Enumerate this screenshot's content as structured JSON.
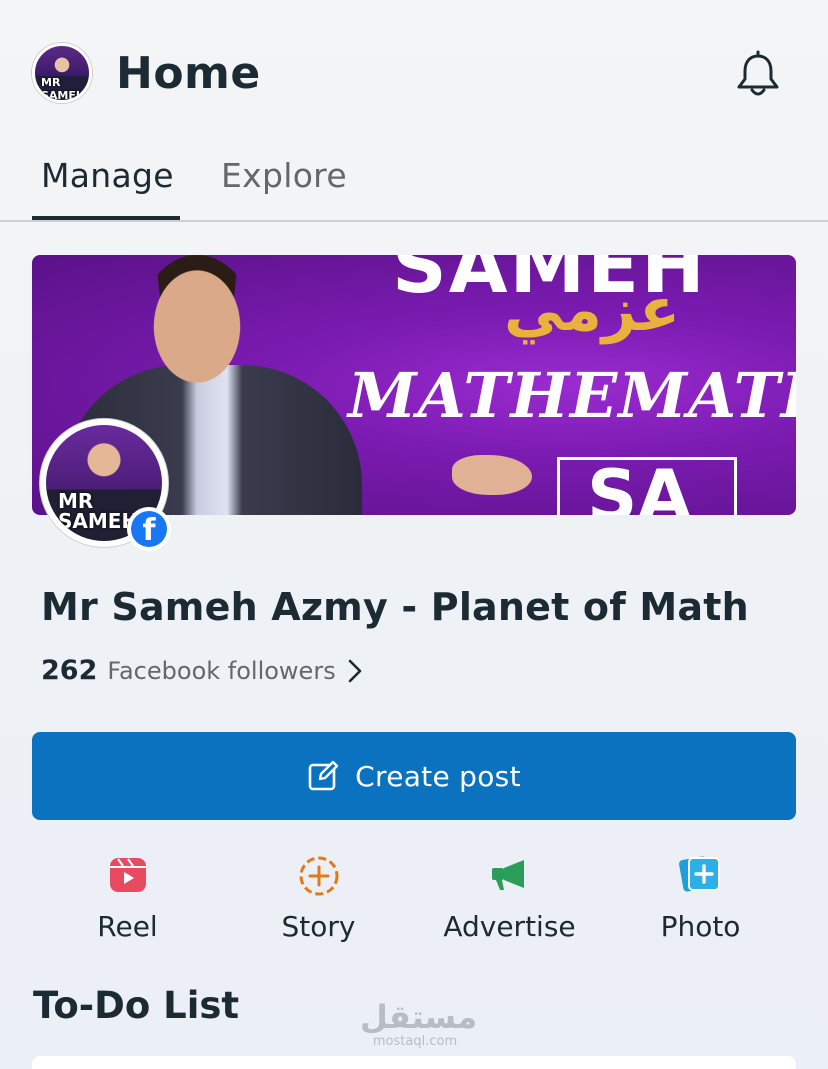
{
  "header": {
    "title": "Home",
    "avatar_text": "MR SAMEH",
    "bell_icon": "bell-icon"
  },
  "tabs": [
    {
      "label": "Manage",
      "active": true
    },
    {
      "label": "Explore",
      "active": false
    }
  ],
  "cover": {
    "brand_text": "SAMEH",
    "arabic_text": "عزمي",
    "subject_text": "MATHEMATICS",
    "box_text": "SA",
    "profile_text": "MR SAMEH",
    "badge": "f"
  },
  "page": {
    "name": "Mr Sameh Azmy - Planet of Math",
    "followers_count": "262",
    "followers_label": "Facebook followers"
  },
  "create_post": {
    "label": "Create post",
    "icon": "edit-icon"
  },
  "actions": [
    {
      "label": "Reel",
      "icon": "reel-icon",
      "color": "#e84a5f"
    },
    {
      "label": "Story",
      "icon": "story-add-icon",
      "color": "#e07a1a"
    },
    {
      "label": "Advertise",
      "icon": "megaphone-icon",
      "color": "#2a9d5a"
    },
    {
      "label": "Photo",
      "icon": "photo-add-icon",
      "color": "#1e9fd8"
    }
  ],
  "todo": {
    "title": "To-Do List"
  },
  "watermark": {
    "arabic": "مستقل",
    "latin": "mostaql.com"
  },
  "colors": {
    "primary_button": "#0a72bf",
    "text_dark": "#1c2b33",
    "text_muted": "#65676b",
    "facebook_blue": "#1877f2"
  }
}
